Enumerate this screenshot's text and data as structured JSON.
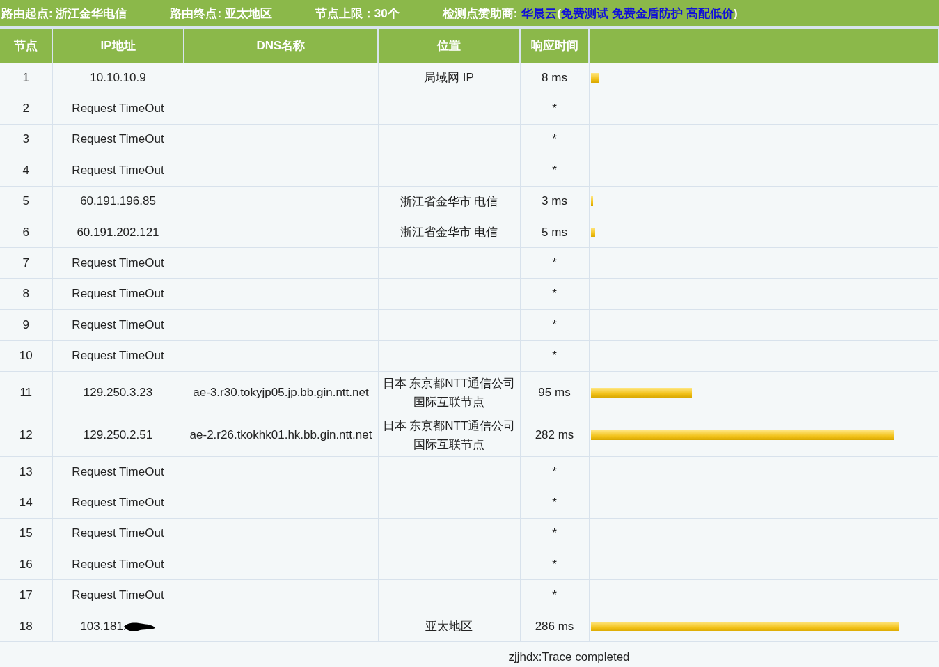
{
  "top_bar": {
    "items": [
      "路由起点: 浙江金华电信",
      "路由终点: 亚太地区",
      "节点上限：30个"
    ],
    "sponsor_label": "检测点赞助商:",
    "sponsor_name": "华晨云",
    "open": "(",
    "links": [
      "免费测试",
      "免费金盾防护",
      "高配低价"
    ],
    "close": ")"
  },
  "table": {
    "columns": [
      "节点",
      "IP地址",
      "DNS名称",
      "位置",
      "响应时间"
    ],
    "rows": [
      {
        "node": "1",
        "ip": "10.10.10.9",
        "location": "局域网 IP",
        "time": "8 ms",
        "level": 0.024
      },
      {
        "node": "2",
        "ip": "Request TimeOut",
        "time": "*"
      },
      {
        "node": "3",
        "ip": "Request TimeOut",
        "time": "*"
      },
      {
        "node": "4",
        "ip": "Request TimeOut",
        "time": "*"
      },
      {
        "node": "5",
        "ip": "60.191.196.85",
        "location": "浙江省金华市 电信",
        "time": "3 ms",
        "level": 0.008
      },
      {
        "node": "6",
        "ip": "60.191.202.121",
        "location": "浙江省金华市 电信",
        "time": "5 ms",
        "level": 0.014
      },
      {
        "node": "7",
        "ip": "Request TimeOut",
        "time": "*"
      },
      {
        "node": "8",
        "ip": "Request TimeOut",
        "time": "*"
      },
      {
        "node": "9",
        "ip": "Request TimeOut",
        "time": "*"
      },
      {
        "node": "10",
        "ip": "Request TimeOut",
        "time": "*"
      },
      {
        "node": "11",
        "ip": "129.250.3.23",
        "dns": "ae-3.r30.tokyjp05.jp.bb.gin.ntt.net",
        "location": "日本 东京都NTT通信公司国际互联节点",
        "time": "95 ms",
        "level": 0.293
      },
      {
        "node": "12",
        "ip": "129.250.2.51",
        "dns": "ae-2.r26.tkokhk01.hk.bb.gin.ntt.net",
        "location": "日本 东京都NTT通信公司国际互联节点",
        "time": "282 ms",
        "level": 0.875
      },
      {
        "node": "13",
        "ip": "Request TimeOut",
        "time": "*"
      },
      {
        "node": "14",
        "ip": "Request TimeOut",
        "time": "*"
      },
      {
        "node": "15",
        "ip": "Request TimeOut",
        "time": "*"
      },
      {
        "node": "16",
        "ip": "Request TimeOut",
        "time": "*"
      },
      {
        "node": "17",
        "ip": "Request TimeOut",
        "time": "*"
      },
      {
        "node": "18",
        "ip": "103.181.",
        "redacted": true,
        "location": "亚太地区",
        "time": "286 ms",
        "level": 0.891
      }
    ]
  },
  "footer": "zjjhdx:Trace completed"
}
